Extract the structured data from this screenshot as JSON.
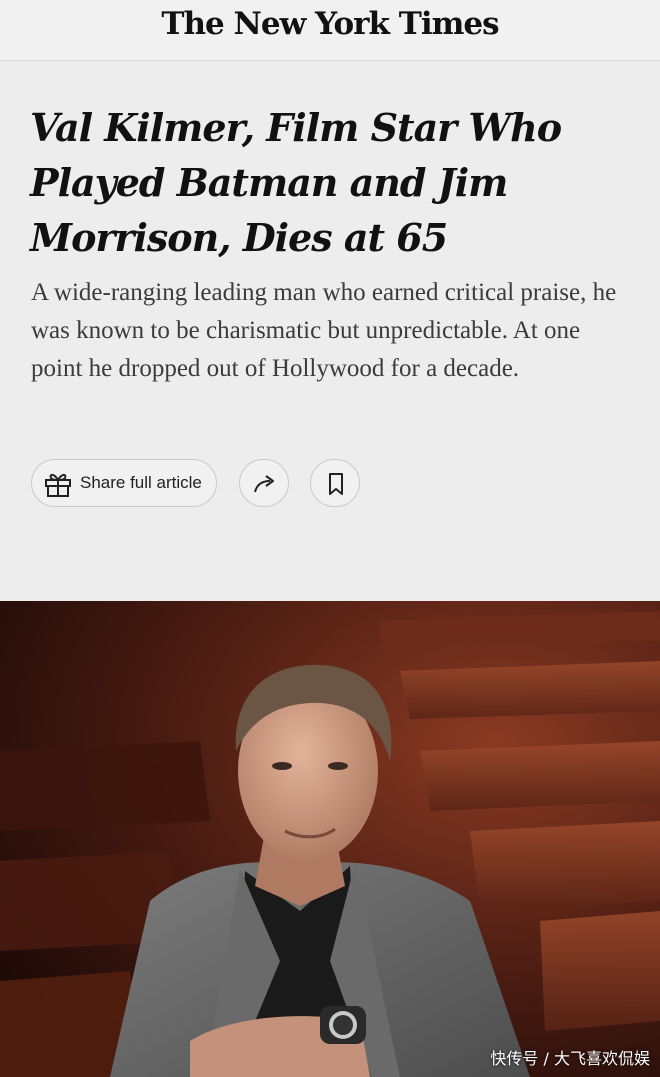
{
  "masthead": {
    "logo": "The New York Times"
  },
  "article": {
    "headline": "Val Kilmer, Film Star Who Played Batman and Jim Morrison, Dies at 65",
    "summary": "A wide-ranging leading man who earned critical praise, he was known to be charismatic but unpredictable. At one point he dropped out of Hollywood for a decade."
  },
  "actions": {
    "share_label": "Share full article",
    "share_icon": "gift-icon",
    "forward_icon": "share-arrow-icon",
    "bookmark_icon": "bookmark-icon"
  },
  "hero": {
    "alt": "Portrait photo of a man in a grey blazer seated in theatre seats"
  },
  "watermark": {
    "text": "快传号 / 大飞喜欢侃娱"
  },
  "colors": {
    "header_bg": "#ededed",
    "text": "#111111",
    "summary_text": "#3b3b3b",
    "button_border": "#c9c9c9"
  }
}
